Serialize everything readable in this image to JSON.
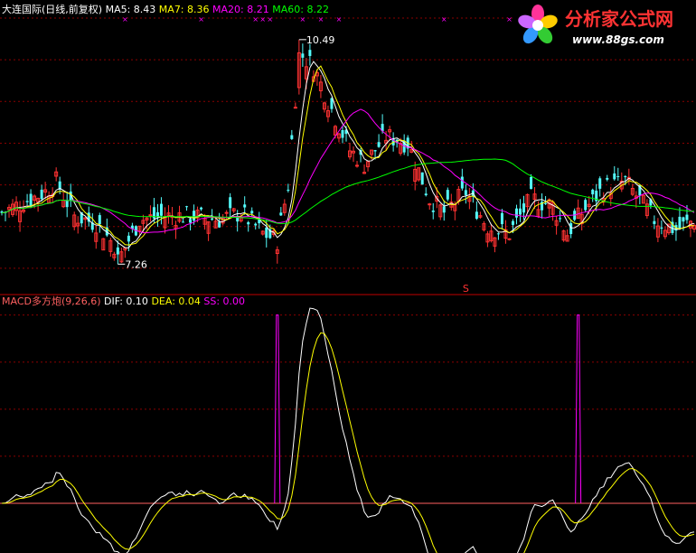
{
  "chart_data": [
    {
      "type": "candlestick",
      "title": "大连国际(日线,前复权)",
      "indicators": [
        {
          "name": "MA5:",
          "value": "8.43",
          "color": "#ffffff"
        },
        {
          "name": "MA7:",
          "value": "8.36",
          "color": "#ffff00"
        },
        {
          "name": "MA20:",
          "value": "8.21",
          "color": "#ff00ff"
        },
        {
          "name": "MA60:",
          "value": "8.22",
          "color": "#00ff00"
        }
      ],
      "ylim": [
        6.9,
        10.8
      ],
      "gridlines": [
        7.2,
        7.8,
        8.4,
        9.0,
        9.6,
        10.2,
        10.8
      ],
      "annotations": [
        {
          "label": "10.49",
          "index": 82,
          "price": 10.49
        },
        {
          "label": "7.26",
          "index": 32,
          "price": 7.26
        }
      ],
      "signal_label": "S",
      "colors": {
        "up": "#ff3232",
        "down": "#54fcfc",
        "grid": "#ff0000",
        "text": "#ffffff"
      }
    },
    {
      "type": "line",
      "title": "MACD多方炮(9,26,6)",
      "series": [
        {
          "name": "DIF:",
          "value": "0.10",
          "color": "#ffffff"
        },
        {
          "name": "DEA:",
          "value": "0.04",
          "color": "#ffff00"
        },
        {
          "name": "SS:",
          "value": "0.00",
          "color": "#ff00ff"
        }
      ],
      "ylim": [
        -0.19,
        0.75
      ],
      "signal_indices": [
        76,
        159
      ]
    }
  ],
  "logo": {
    "text": "分析家公式网",
    "url": "www.88gs.com"
  }
}
